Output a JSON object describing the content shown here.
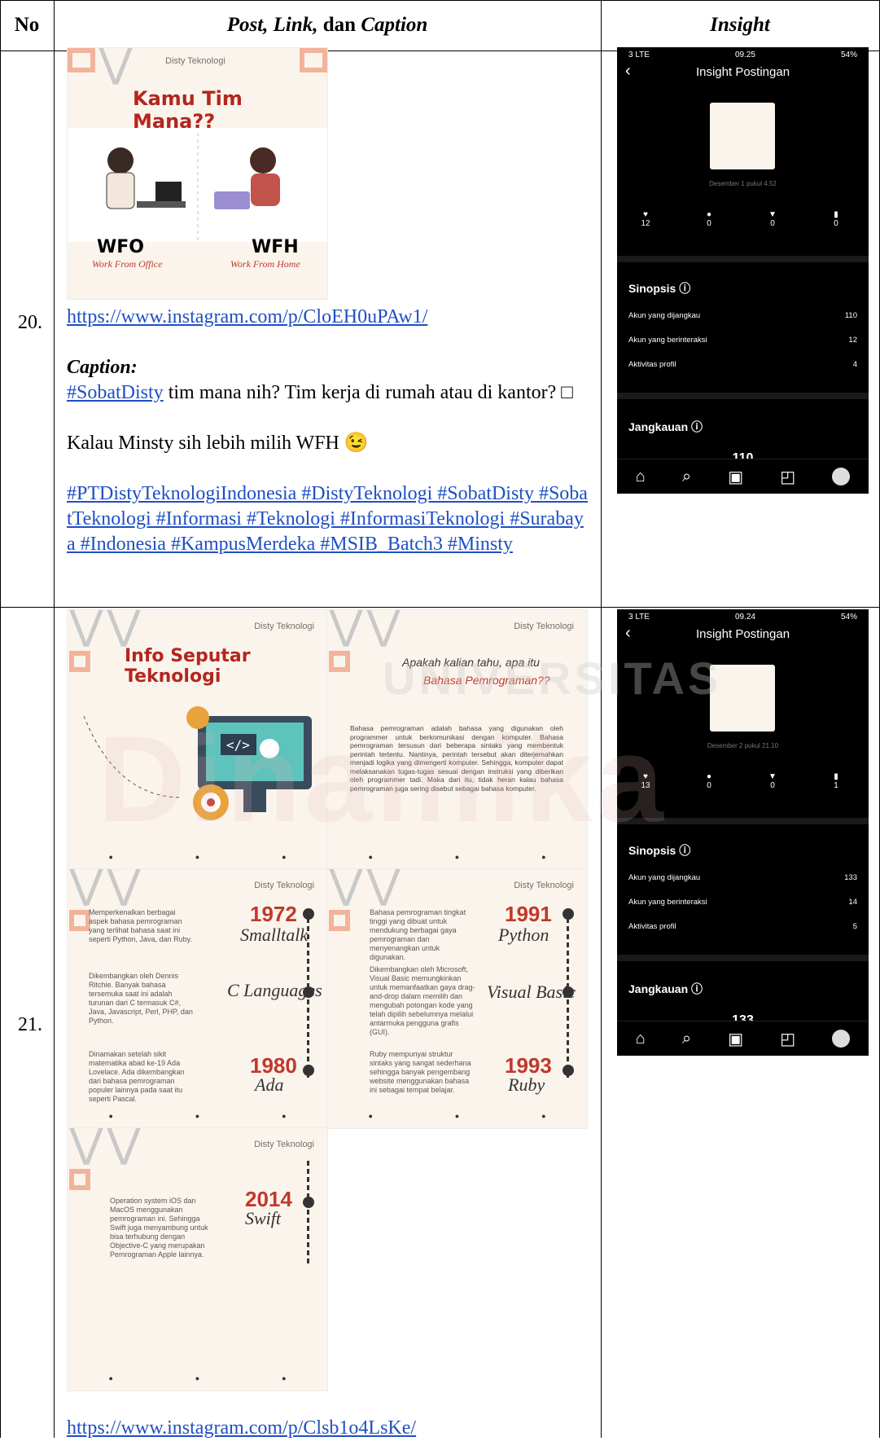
{
  "table": {
    "headers": {
      "no": "No",
      "post_prefix_italic": "Post, Link,",
      "post_mid": "dan",
      "post_suffix_italic": "Caption",
      "insight": "Insight"
    }
  },
  "rows": [
    {
      "number": "20.",
      "post_image": {
        "brand": "Disty Teknologi",
        "title": "Kamu Tim Mana??",
        "left_label": "WFO",
        "left_sub": "Work From Office",
        "right_label": "WFH",
        "right_sub": "Work From Home"
      },
      "link": "https://www.instagram.com/p/CloEH0uPAw1/",
      "caption_label": "Caption:",
      "caption_tag": "#SobatDisty",
      "caption_line1": " tim mana nih? Tim kerja di rumah atau di kantor? □",
      "caption_line2": "Kalau Minsty sih lebih milih WFH 😉",
      "hashtags": "#PTDistyTeknologiIndonesia #DistyTeknologi #SobatDisty #SobatTeknologi #Informasi #Teknologi #InformasiTeknologi #Surabaya #Indonesia #KampusMerdeka #MSIB_Batch3 #Minsty",
      "insight": {
        "status_left": "3 LTE",
        "time": "09.25",
        "status_right": "54%",
        "title": "Insight Postingan",
        "date": "Desember 1 pukul 4.52",
        "stats": [
          "12",
          "0",
          "0",
          "0"
        ],
        "sinopsis": "Sinopsis ⓘ",
        "rows": [
          {
            "label": "Akun yang dijangkau",
            "value": "110"
          },
          {
            "label": "Akun yang berinteraksi",
            "value": "12"
          },
          {
            "label": "Aktivitas profil",
            "value": "4"
          }
        ],
        "jangkauan": "Jangkauan ⓘ",
        "partial": "110"
      }
    },
    {
      "number": "21.",
      "post_images": {
        "brand": "Disty Teknologi",
        "slide1_title": "Info Seputar Teknologi",
        "slide2_title1": "Apakah kalian tahu, apa itu",
        "slide2_title2": "Bahasa Pemrograman??",
        "slide2_body": "Bahasa pemrograman adalah bahasa yang digunakan oleh programmer untuk berkomunikasi dengan komputer. Bahasa pemrograman tersusun dari beberapa sintaks yang membentuk perintah tertentu. Nantinya, perintah tersebut akan diterjemahkan menjadi logika yang dimengerti komputer. Sehingga, komputer dapat melaksanakan tugas-tugas sesuai dengan instruksi yang diberikan oleh programmer tadi. Maka dari itu, tidak heran kalau bahasa pemrograman juga sering disebut sebagai bahasa komputer.",
        "timeline_a": [
          {
            "year": "1972",
            "lang": "Smalltalk",
            "text": "Memperkenalkan berbagai aspek bahasa pemrograman yang terlihat bahasa saat ini seperti Python, Java, dan Ruby."
          },
          {
            "year": "",
            "lang": "C Languages",
            "text": "Dikembangkan oleh Dennis Ritchie. Banyak bahasa tersemuka saat ini adalah turunan dari C termasuk C#, Java, Javascript, Perl, PHP, dan Python."
          },
          {
            "year": "1980",
            "lang": "Ada",
            "text": "Dinamakan setelah sikit matematika abad ke-19 Ada Lovelace. Ada dikembangkan dari bahasa pemrograman populer lainnya pada saat itu seperti Pascal."
          }
        ],
        "timeline_b": [
          {
            "year": "1991",
            "lang": "Python",
            "text": "Bahasa pemrograman tingkat tinggi yang dibuat untuk mendukung berbagai gaya pemrograman dan menyenangkan untuk digunakan."
          },
          {
            "year": "",
            "lang": "Visual Basic",
            "text": "Dikembangkan oleh Microsoft, Visual Basic memungkinkan untuk memanfaatkan gaya drag-and-drop dalam memilih dan mengubah potongan kode yang telah dipilih sebelumnya melalui antarmuka pengguna grafis (GUI)."
          },
          {
            "year": "1993",
            "lang": "Ruby",
            "text": "Ruby mempunyai struktur sintaks yang sangat sederhana sehingga banyak pengembang website menggunakan bahasa ini sebagai tempat belajar."
          }
        ],
        "timeline_c": [
          {
            "year": "2014",
            "lang": "Swift",
            "text": "Operation system iOS dan MacOS menggunakan pemrograman ini. Sehingga Swift juga menyambung untuk bisa terhubung dengan Objective-C yang merupakan Pemrograman Apple lainnya."
          }
        ]
      },
      "link": "https://www.instagram.com/p/Clsb1o4LsKe/",
      "insight": {
        "status_left": "3 LTE",
        "time": "09.24",
        "status_right": "54%",
        "title": "Insight Postingan",
        "date": "Desember 2 pukul 21.10",
        "stats": [
          "13",
          "0",
          "0",
          "1"
        ],
        "sinopsis": "Sinopsis ⓘ",
        "rows": [
          {
            "label": "Akun yang dijangkau",
            "value": "133"
          },
          {
            "label": "Akun yang berinteraksi",
            "value": "14"
          },
          {
            "label": "Aktivitas profil",
            "value": "5"
          }
        ],
        "jangkauan": "Jangkauan ⓘ",
        "partial": "133"
      }
    }
  ],
  "watermark": {
    "text1": "UNIVERSITAS",
    "text2": "Dinamika"
  }
}
